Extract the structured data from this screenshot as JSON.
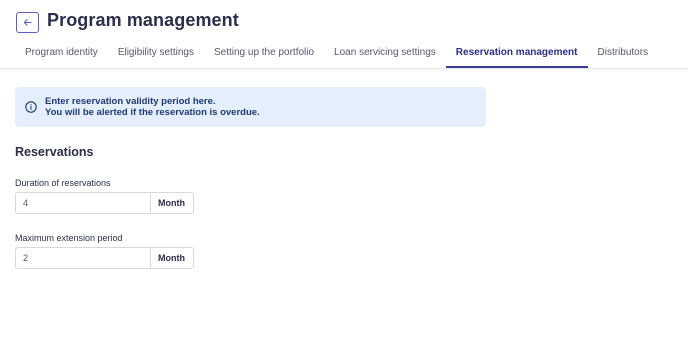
{
  "header": {
    "title": "Program management",
    "back_icon": "arrow-left-icon"
  },
  "tabs": [
    {
      "label": "Program identity",
      "active": false
    },
    {
      "label": "Eligibility settings",
      "active": false
    },
    {
      "label": "Setting up the portfolio",
      "active": false
    },
    {
      "label": "Loan servicing settings",
      "active": false
    },
    {
      "label": "Reservation management",
      "active": true
    },
    {
      "label": "Distributors",
      "active": false
    }
  ],
  "alert": {
    "icon": "info-icon",
    "line1": "Enter reservation validity period here.",
    "line2": "You will be alerted if the reservation is overdue."
  },
  "reservations": {
    "title": "Reservations",
    "duration": {
      "label": "Duration of reservations",
      "value": "4",
      "unit": "Month"
    },
    "extension": {
      "label": "Maximum extension period",
      "value": "2",
      "unit": "Month"
    }
  },
  "colors": {
    "accent": "#3b3d9a",
    "alert_bg": "#e4eefc",
    "alert_text": "#1f3a73"
  }
}
